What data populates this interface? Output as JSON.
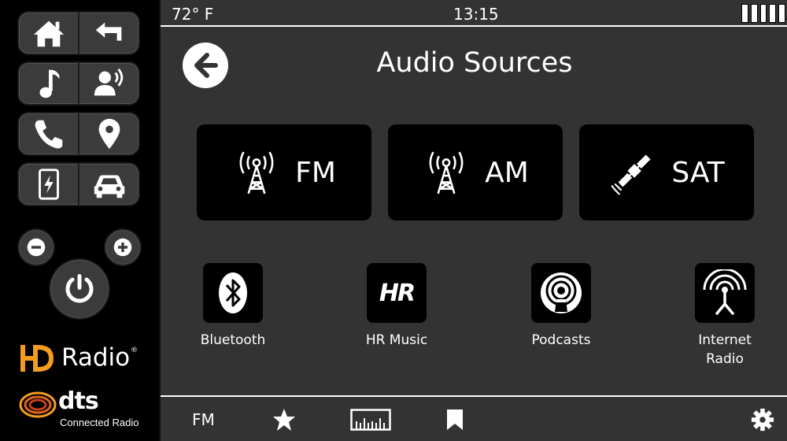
{
  "status": {
    "temperature": "72° F",
    "time": "13:15",
    "signal_bars": 5
  },
  "title": "Audio Sources",
  "tiles": [
    {
      "label": "FM",
      "icon": "radio-tower-icon"
    },
    {
      "label": "AM",
      "icon": "radio-tower-icon"
    },
    {
      "label": "SAT",
      "icon": "satellite-icon"
    }
  ],
  "sources": [
    {
      "label": "Bluetooth",
      "icon": "bluetooth-icon"
    },
    {
      "label": "HR Music",
      "icon": "hr-logo-icon",
      "logo_text": "HR"
    },
    {
      "label": "Podcasts",
      "icon": "podcast-icon"
    },
    {
      "label_line1": "Internet",
      "label_line2": "Radio",
      "icon": "antenna-icon"
    }
  ],
  "bottom_bar": {
    "band": "FM"
  },
  "left_panel": {
    "buttons": [
      "home-icon",
      "return-icon",
      "music-note-icon",
      "voice-icon",
      "phone-icon",
      "location-pin-icon",
      "phone-projection-icon",
      "car-icon"
    ]
  },
  "logos": {
    "hd_radio": "Radio",
    "dts": "dts",
    "dts_sub": "Connected Radio"
  },
  "colors": {
    "hd_orange": "#f39c1e",
    "screen_bg": "#333333",
    "tile_bg": "#000000"
  }
}
